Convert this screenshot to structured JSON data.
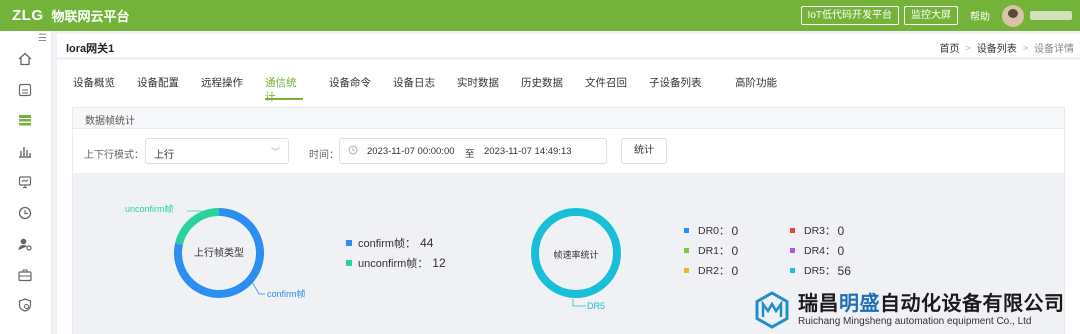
{
  "app": {
    "logo": "ZLG",
    "name": "物联网云平台"
  },
  "topbar": {
    "btn_lowcode": "IoT低代码开发平台",
    "btn_monitor": "监控大屏",
    "help": "帮助"
  },
  "sidebar": {
    "toggle": "☰",
    "icons": [
      "home-icon",
      "gateway-icon",
      "device-list-icon",
      "chart-icon",
      "monitor-icon",
      "clock-icon",
      "user-settings-icon",
      "toolbox-icon",
      "shield-icon"
    ]
  },
  "header": {
    "title": "lora网关1",
    "breadcrumbs": [
      "首页",
      "设备列表",
      "设备详情"
    ]
  },
  "tabs": [
    "设备概览",
    "设备配置",
    "远程操作",
    "通信统计",
    "设备命令",
    "设备日志",
    "实时数据",
    "历史数据",
    "文件召回",
    "子设备列表",
    "高阶功能"
  ],
  "active_tab": "通信统计",
  "panel": {
    "title": "数据帧统计",
    "mode_label": "上下行模式：",
    "mode_value": "上行",
    "time_label": "时间：",
    "date_start": "2023-11-07 00:00:00",
    "date_sep": "至",
    "date_end": "2023-11-07 14:49:13",
    "stat_button": "统计"
  },
  "colors": {
    "brand": "#73b339",
    "confirm": "#2b8ef0",
    "unconfirm": "#2bd39c",
    "dr5": "#19bfd8"
  },
  "chart_data": [
    {
      "type": "pie",
      "title": "上行帧类型",
      "labels": [
        "confirm帧",
        "unconfirm帧"
      ],
      "values": [
        44,
        12
      ],
      "legend": [
        {
          "name": "confirm帧：",
          "value": "44"
        },
        {
          "name": "unconfirm帧：",
          "value": "12"
        }
      ]
    },
    {
      "type": "pie",
      "title": "帧速率统计",
      "labels": [
        "DR0",
        "DR1",
        "DR2",
        "DR3",
        "DR4",
        "DR5"
      ],
      "values": [
        0,
        0,
        0,
        0,
        0,
        56
      ],
      "slice_label": "DR5",
      "legend": [
        {
          "name": "DR0：",
          "value": "0",
          "color": "#2b8ef0"
        },
        {
          "name": "DR1：",
          "value": "0",
          "color": "#7ac943"
        },
        {
          "name": "DR2：",
          "value": "0",
          "color": "#f0b429"
        },
        {
          "name": "DR3：",
          "value": "0",
          "color": "#e8473c"
        },
        {
          "name": "DR4：",
          "value": "0",
          "color": "#b356e0"
        },
        {
          "name": "DR5：",
          "value": "56",
          "color": "#19bfd8"
        }
      ]
    }
  ],
  "watermark": {
    "cn_a": "瑞昌",
    "cn_b": "明盛",
    "cn_c": "自动化设备有限公司",
    "en": "Ruichang Mingsheng automation equipment Co., Ltd"
  }
}
